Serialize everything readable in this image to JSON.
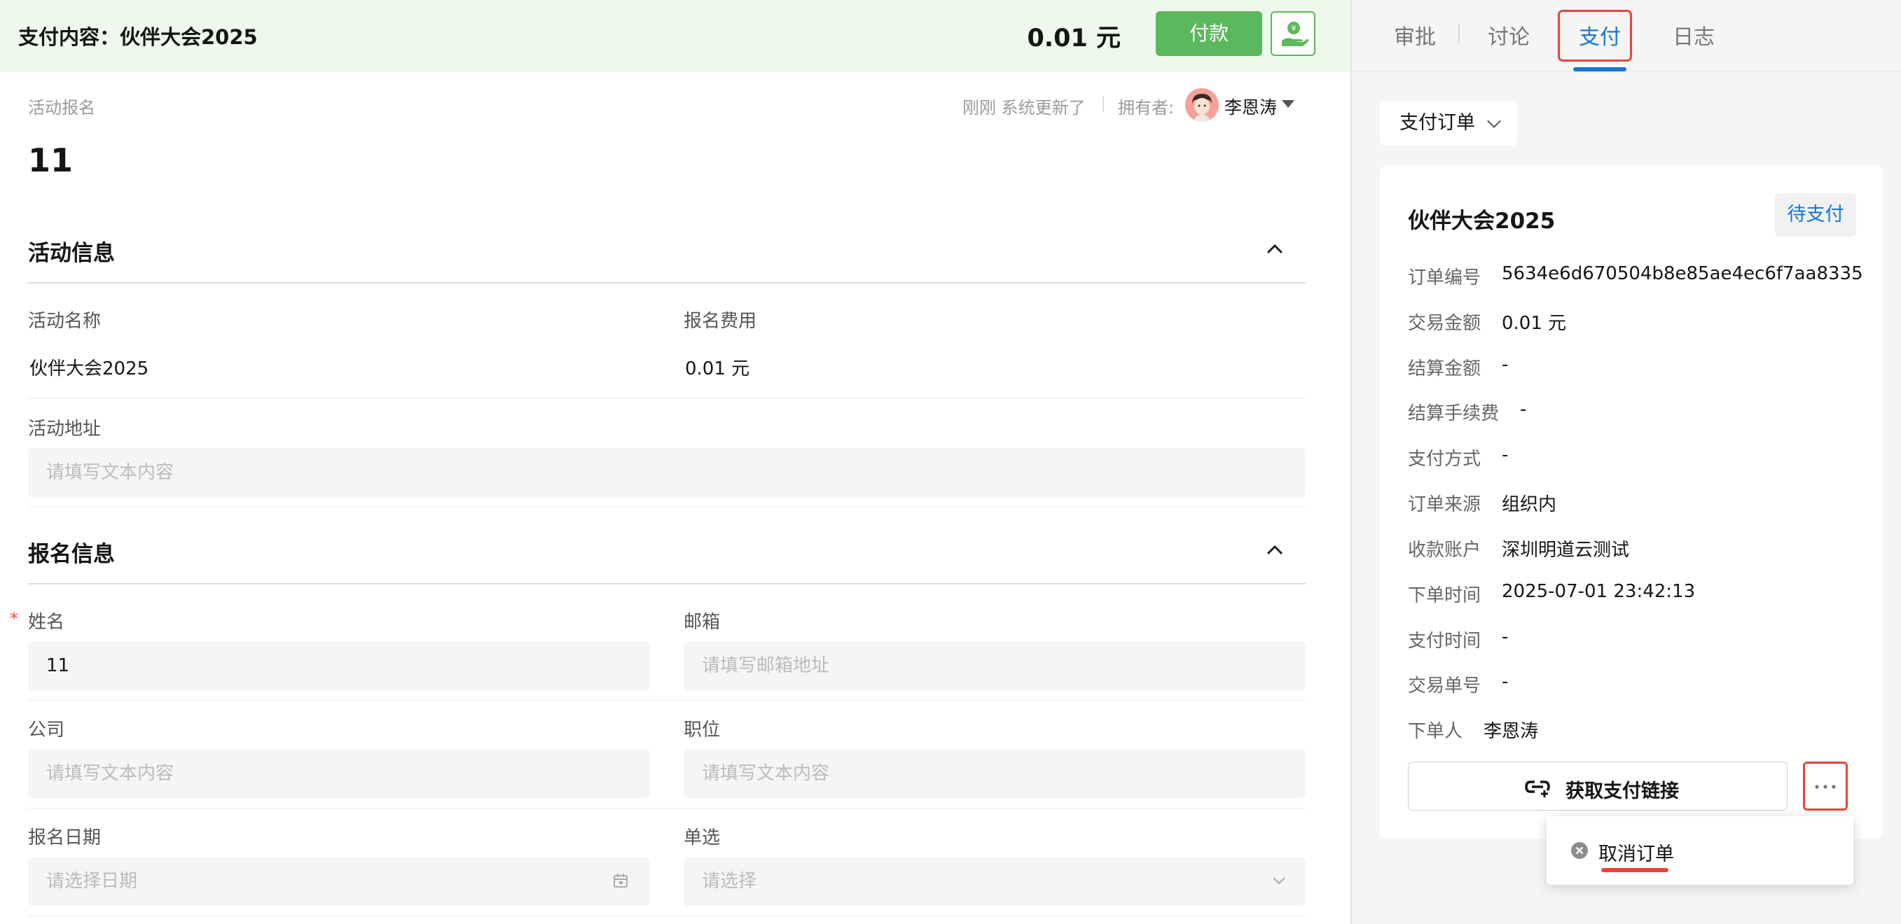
{
  "paybar": {
    "title": "支付内容：伙伴大会2025",
    "amount": "0.01 元",
    "pay_label": "付款"
  },
  "record": {
    "category": "活动报名",
    "updated": "刚刚 系统更新了",
    "owner_label": "拥有者:",
    "owner_name": "李恩涛",
    "title": "11"
  },
  "sections": {
    "activity": {
      "title": "活动信息",
      "name_label": "活动名称",
      "name_value": "伙伴大会2025",
      "fee_label": "报名费用",
      "fee_value": "0.01 元",
      "address_label": "活动地址",
      "address_placeholder": "请填写文本内容"
    },
    "signup": {
      "title": "报名信息",
      "name_label": "姓名",
      "name_value": "11",
      "email_label": "邮箱",
      "email_placeholder": "请填写邮箱地址",
      "company_label": "公司",
      "company_placeholder": "请填写文本内容",
      "position_label": "职位",
      "position_placeholder": "请填写文本内容",
      "date_label": "报名日期",
      "date_placeholder": "请选择日期",
      "choice_label": "单选",
      "choice_placeholder": "请选择"
    }
  },
  "tabs": [
    {
      "label": "审批"
    },
    {
      "label": "讨论"
    },
    {
      "label": "支付"
    },
    {
      "label": "日志"
    }
  ],
  "order_select": "支付订单",
  "order": {
    "title": "伙伴大会2025",
    "status": "待支付",
    "fields": [
      {
        "label": "订单编号",
        "value": "5634e6d670504b8e85ae4ec6f7aa8335"
      },
      {
        "label": "交易金额",
        "value": "0.01 元"
      },
      {
        "label": "结算金额",
        "value": "-"
      },
      {
        "label": "结算手续费",
        "value": "-"
      },
      {
        "label": "支付方式",
        "value": "-"
      },
      {
        "label": "订单来源",
        "value": "组织内"
      },
      {
        "label": "收款账户",
        "value": "深圳明道云测试"
      },
      {
        "label": "下单时间",
        "value": "2025-07-01 23:42:13"
      },
      {
        "label": "支付时间",
        "value": "-"
      },
      {
        "label": "交易单号",
        "value": "-"
      },
      {
        "label": "下单人",
        "value": "李恩涛"
      }
    ],
    "link_button": "获取支付链接"
  },
  "dropdown": {
    "cancel_label": "取消订单"
  },
  "colors": {
    "accent_blue": "#1677d2",
    "pay_green": "#5cb85c",
    "highlight_red": "#e8443a"
  }
}
